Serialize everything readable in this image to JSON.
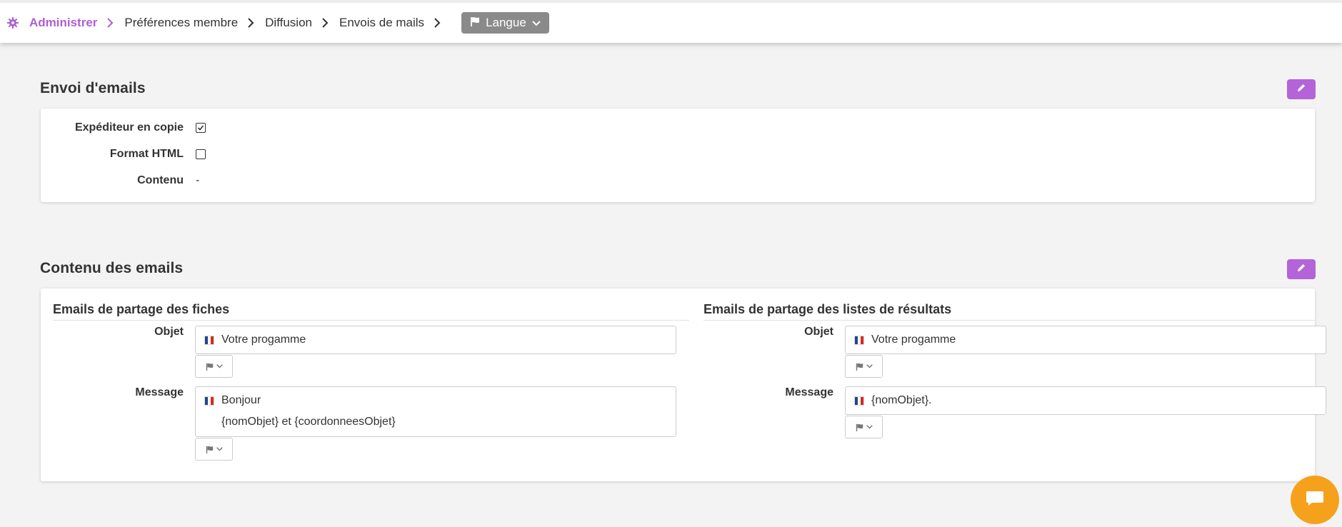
{
  "breadcrumb": {
    "items": [
      "Administrer",
      "Préférences membre",
      "Diffusion",
      "Envois de mails"
    ],
    "language_button": "Langue"
  },
  "section_envoi": {
    "title": "Envoi d'emails",
    "rows": [
      {
        "label": "Expéditeur en copie",
        "checked": true
      },
      {
        "label": "Format HTML",
        "checked": false
      },
      {
        "label": "Contenu",
        "value": "-"
      }
    ]
  },
  "section_contenu": {
    "title": "Contenu des emails",
    "fiches": {
      "title": "Emails de partage des fiches",
      "objet_label": "Objet",
      "objet_value": "Votre progamme",
      "message_label": "Message",
      "message_line1": "Bonjour",
      "message_line2": "{nomObjet} et {coordonneesObjet}"
    },
    "listes": {
      "title": "Emails de partage des listes de résultats",
      "objet_label": "Objet",
      "objet_value": "Votre progamme",
      "message_label": "Message",
      "message_value": "{nomObjet}."
    }
  },
  "colors": {
    "accent": "#b563d8",
    "chat": "#f5a11c",
    "language_button": "#8a8a8a"
  },
  "icons": [
    "gear-icon",
    "chevron-right-icon",
    "flag-icon",
    "chevron-down-icon",
    "pencil-icon",
    "chat-icon",
    "check-icon",
    "french-flag-icon"
  ]
}
